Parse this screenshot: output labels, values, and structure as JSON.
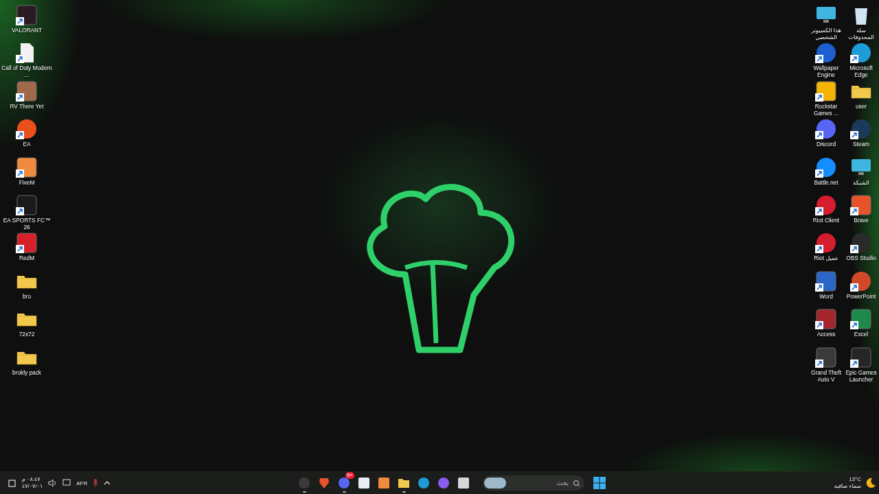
{
  "desktop": {
    "left_icons": [
      {
        "label": "VALORANT",
        "kind": "app",
        "color": "#2a1a24",
        "shortcut": true
      },
      {
        "label": "Call of Duty Modern ...",
        "kind": "file",
        "color": "#f2f2f2",
        "shortcut": true
      },
      {
        "label": "RV There Yet",
        "kind": "app",
        "color": "#a06a4a",
        "shortcut": true
      },
      {
        "label": "EA",
        "kind": "round",
        "color": "#e8501c",
        "shortcut": true
      },
      {
        "label": "FiveM",
        "kind": "app",
        "color": "#f08a3c",
        "shortcut": true
      },
      {
        "label": "EA SPORTS FC™ 26",
        "kind": "app",
        "color": "#1a1a1a",
        "shortcut": true
      },
      {
        "label": "RedM",
        "kind": "app",
        "color": "#d8202a",
        "shortcut": true
      },
      {
        "label": "bro",
        "kind": "folder",
        "color": "#f2c94c",
        "shortcut": false
      },
      {
        "label": "72x72",
        "kind": "folder",
        "color": "#f2c94c",
        "shortcut": false
      },
      {
        "label": "brokly pack",
        "kind": "folder",
        "color": "#f2c94c",
        "shortcut": false
      }
    ],
    "right_icons": [
      {
        "label": "هذا الكمبيوتر الشخصي",
        "kind": "monitor",
        "color": "#3fb6e0",
        "shortcut": false
      },
      {
        "label": "سلة المحذوفات",
        "kind": "bin",
        "color": "#cfe3f2",
        "shortcut": false
      },
      {
        "label": "Wallpaper Engine",
        "kind": "round",
        "color": "#1d5fd0",
        "shortcut": true
      },
      {
        "label": "Microsoft Edge",
        "kind": "round",
        "color": "#1e9bd8",
        "shortcut": true
      },
      {
        "label": "Rockstar Games ...",
        "kind": "app",
        "color": "#f4b400",
        "shortcut": true
      },
      {
        "label": "user",
        "kind": "folder",
        "color": "#f2c94c",
        "shortcut": false
      },
      {
        "label": "Discord",
        "kind": "round",
        "color": "#5865f2",
        "shortcut": true
      },
      {
        "label": "Steam",
        "kind": "round",
        "color": "#1b3a5a",
        "shortcut": true
      },
      {
        "label": "Battle.net",
        "kind": "round",
        "color": "#148eff",
        "shortcut": true
      },
      {
        "label": "الشبكة",
        "kind": "monitor",
        "color": "#3fb6e0",
        "shortcut": false
      },
      {
        "label": "Riot Client",
        "kind": "round",
        "color": "#d41e2e",
        "shortcut": true
      },
      {
        "label": "Brave",
        "kind": "app",
        "color": "#e8542a",
        "shortcut": true
      },
      {
        "label": "عميل Riot",
        "kind": "round",
        "color": "#d41e2e",
        "shortcut": true
      },
      {
        "label": "OBS Studio",
        "kind": "round",
        "color": "#2a2a2a",
        "shortcut": true
      },
      {
        "label": "Word",
        "kind": "app",
        "color": "#2b66c8",
        "shortcut": true
      },
      {
        "label": "PowerPoint",
        "kind": "round",
        "color": "#d2492a",
        "shortcut": true
      },
      {
        "label": "Access",
        "kind": "app",
        "color": "#a4262c",
        "shortcut": true
      },
      {
        "label": "Excel",
        "kind": "app",
        "color": "#1d8a4a",
        "shortcut": true
      },
      {
        "label": "Grand Theft Auto V",
        "kind": "app",
        "color": "#3a3a3a",
        "shortcut": true
      },
      {
        "label": "Epic Games Launcher",
        "kind": "app",
        "color": "#262626",
        "shortcut": true
      }
    ]
  },
  "taskbar": {
    "tray": {
      "time": "٠٨:٤٧ م",
      "date": "٤٧/٠٧/٠١",
      "language": "AFR"
    },
    "apps": [
      {
        "kind": "round",
        "color": "#3a3a3a",
        "running": true
      },
      {
        "kind": "shield",
        "color": "#e8542a",
        "running": false
      },
      {
        "kind": "round",
        "color": "#5865f2",
        "running": true,
        "badge": "9+"
      },
      {
        "kind": "square",
        "color": "#e9eef3",
        "running": false
      },
      {
        "kind": "square",
        "color": "#f08a3c",
        "running": false
      },
      {
        "kind": "folder",
        "color": "#f2c94c",
        "running": true
      },
      {
        "kind": "round",
        "color": "#1e9bd8",
        "running": false
      },
      {
        "kind": "round",
        "color": "#8a5cf0",
        "running": false
      },
      {
        "kind": "square",
        "color": "#d8d8d8",
        "running": false
      }
    ],
    "search": {
      "placeholder": "بحث"
    },
    "weather": {
      "temperature": "13°C",
      "condition": "سماء صافية"
    }
  }
}
